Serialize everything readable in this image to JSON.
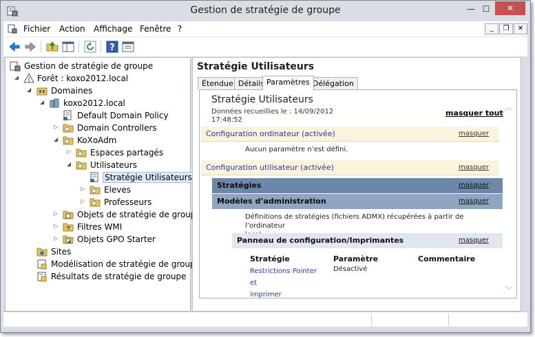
{
  "window": {
    "title": "Gestion de stratégie de groupe",
    "close_glyph": "✕",
    "min_glyph": "—",
    "max_glyph": "☐"
  },
  "menu": {
    "items": [
      "Fichier",
      "Action",
      "Affichage",
      "Fenêtre",
      "?"
    ]
  },
  "toolbar": {
    "icons": [
      "back-icon",
      "forward-icon",
      "folder-up-icon",
      "console-tree-icon",
      "refresh-icon",
      "help-icon",
      "properties-icon"
    ]
  },
  "tree": {
    "nodes": [
      {
        "label": "Gestion de stratégie de groupe",
        "icon": "gpmc-icon"
      },
      {
        "label": "Forêt : koxo2012.local",
        "icon": "forest-icon"
      },
      {
        "label": "Domaines",
        "icon": "domains-icon"
      },
      {
        "label": "koxo2012.local",
        "icon": "domain-icon"
      },
      {
        "label": "Default Domain Policy",
        "icon": "gpo-link-icon"
      },
      {
        "label": "Domain Controllers",
        "icon": "ou-folder-icon"
      },
      {
        "label": "KoXoAdm",
        "icon": "ou-folder-icon"
      },
      {
        "label": "Espaces partagés",
        "icon": "ou-folder-icon"
      },
      {
        "label": "Utilisateurs",
        "icon": "ou-folder-icon"
      },
      {
        "label": "Stratégie Utilisateurs",
        "icon": "gpo-link-icon"
      },
      {
        "label": "Eleves",
        "icon": "ou-folder-icon"
      },
      {
        "label": "Professeurs",
        "icon": "ou-folder-icon"
      },
      {
        "label": "Objets de stratégie de groupe",
        "icon": "gpo-folder-icon"
      },
      {
        "label": "Filtres WMI",
        "icon": "wmi-folder-icon"
      },
      {
        "label": "Objets GPO Starter",
        "icon": "starter-folder-icon"
      },
      {
        "label": "Sites",
        "icon": "sites-icon"
      },
      {
        "label": "Modélisation de stratégie de groupe",
        "icon": "modeling-icon"
      },
      {
        "label": "Résultats de stratégie de groupe",
        "icon": "results-icon"
      }
    ]
  },
  "detail": {
    "title": "Stratégie Utilisateurs",
    "tabs": [
      "Étendue",
      "Détails",
      "Paramètres",
      "Délégation"
    ],
    "active_tab": "Paramètres",
    "report": {
      "title": "Stratégie Utilisateurs",
      "date_line1": "Données recueillies le : 14/09/2012",
      "date_line2": "17:48:52",
      "hide_all": "masquer tout",
      "hide": "masquer",
      "computer_section": "Configuration ordinateur (activée)",
      "computer_none": "Aucun paramètre n’est défini.",
      "user_section": "Configuration utilisateur (activée)",
      "policies_section": "Stratégies",
      "admin_models_section": "Modèles d’administration",
      "admx_text_1": "Définitions de stratégies (fichiers ADMX) récupérées à partir de l’ordinateur",
      "admx_text_2": "local.",
      "panel_section": "Panneau de configuration/Imprimantes",
      "col_policy": "Stratégie",
      "col_setting": "Paramètre",
      "col_comment": "Commentaire",
      "policy_name_1": "Restrictions Pointer et",
      "policy_name_2": "imprimer",
      "policy_value": "Désactivé"
    }
  },
  "colors": {
    "section_link": "#2637a6",
    "section_bg": "#fbf3dc",
    "strategies_bg": "#6c88a8",
    "models_bg": "#8ea6bf",
    "close_button": "#c75050"
  }
}
